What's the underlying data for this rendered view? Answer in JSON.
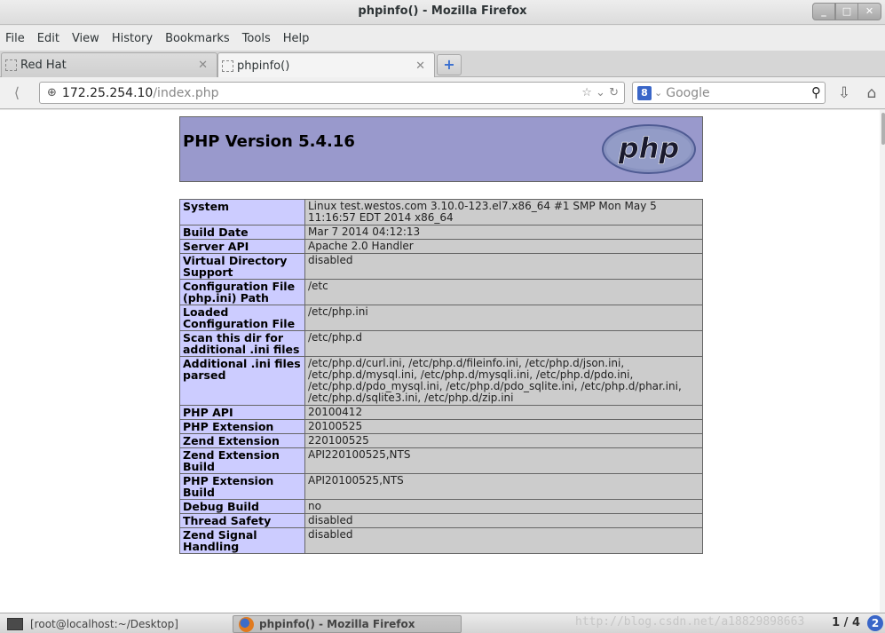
{
  "window": {
    "title": "phpinfo() - Mozilla Firefox"
  },
  "menu": [
    "File",
    "Edit",
    "View",
    "History",
    "Bookmarks",
    "Tools",
    "Help"
  ],
  "tabs": [
    {
      "label": "Red Hat",
      "active": false
    },
    {
      "label": "phpinfo()",
      "active": true
    }
  ],
  "nav": {
    "url_host": "172.25.254.10",
    "url_path": "/index.php",
    "search_placeholder": "Google"
  },
  "page": {
    "heading": "PHP Version 5.4.16",
    "logo_text": "php",
    "rows": [
      {
        "key": "System",
        "value": "Linux test.westos.com 3.10.0-123.el7.x86_64 #1 SMP Mon May 5 11:16:57 EDT 2014 x86_64"
      },
      {
        "key": "Build Date",
        "value": "Mar 7 2014 04:12:13"
      },
      {
        "key": "Server API",
        "value": "Apache 2.0 Handler"
      },
      {
        "key": "Virtual Directory Support",
        "value": "disabled"
      },
      {
        "key": "Configuration File (php.ini) Path",
        "value": "/etc"
      },
      {
        "key": "Loaded Configuration File",
        "value": "/etc/php.ini"
      },
      {
        "key": "Scan this dir for additional .ini files",
        "value": "/etc/php.d"
      },
      {
        "key": "Additional .ini files parsed",
        "value": "/etc/php.d/curl.ini, /etc/php.d/fileinfo.ini, /etc/php.d/json.ini, /etc/php.d/mysql.ini, /etc/php.d/mysqli.ini, /etc/php.d/pdo.ini, /etc/php.d/pdo_mysql.ini, /etc/php.d/pdo_sqlite.ini, /etc/php.d/phar.ini, /etc/php.d/sqlite3.ini, /etc/php.d/zip.ini"
      },
      {
        "key": "PHP API",
        "value": "20100412"
      },
      {
        "key": "PHP Extension",
        "value": "20100525"
      },
      {
        "key": "Zend Extension",
        "value": "220100525"
      },
      {
        "key": "Zend Extension Build",
        "value": "API220100525,NTS"
      },
      {
        "key": "PHP Extension Build",
        "value": "API20100525,NTS"
      },
      {
        "key": "Debug Build",
        "value": "no"
      },
      {
        "key": "Thread Safety",
        "value": "disabled"
      },
      {
        "key": "Zend Signal Handling",
        "value": "disabled"
      }
    ]
  },
  "taskbar": {
    "items": [
      "[root@localhost:~/Desktop]",
      "phpinfo() - Mozilla Firefox"
    ],
    "watermark": "http://blog.csdn.net/a18829898663",
    "pager": "1 / 4",
    "badge": "2"
  },
  "colors": {
    "php_header": "#9999cc",
    "key_cell": "#ccccff",
    "value_cell": "#cccccc"
  }
}
